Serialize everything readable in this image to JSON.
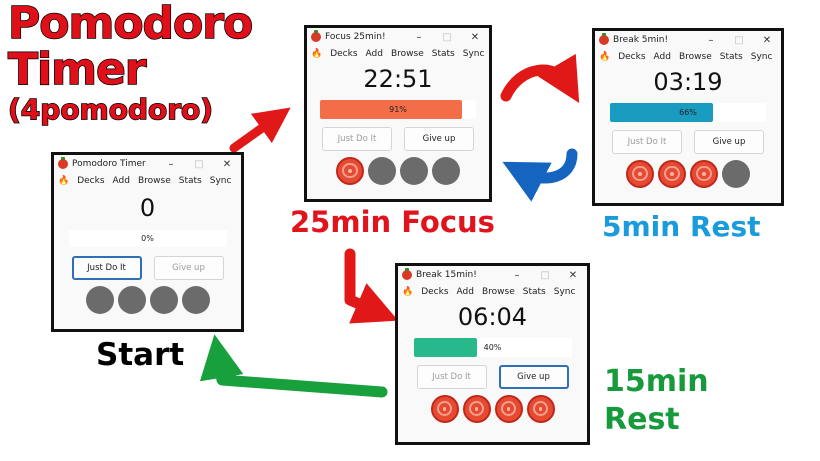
{
  "title": {
    "line1": "Pomodoro",
    "line2": "Timer",
    "line3": "(4pomodoro)",
    "color": "#e0101a"
  },
  "menu": [
    "Decks",
    "Add",
    "Browse",
    "Stats",
    "Sync"
  ],
  "windows": {
    "start": {
      "title": "Pomodoro Timer",
      "timer": "0",
      "progress_label": "0%",
      "progress": 0,
      "fill_color": "#ffffff",
      "btn_left": "Just Do It",
      "btn_right": "Give up",
      "tomatoes_done": 0,
      "tomatoes_total": 4
    },
    "focus": {
      "title": "Focus 25min!",
      "timer": "22:51",
      "progress_label": "91%",
      "progress": 0.91,
      "fill_color": "#f26d48",
      "btn_left": "Just Do It",
      "btn_right": "Give up",
      "tomatoes_done": 1,
      "tomatoes_total": 4
    },
    "break5": {
      "title": "Break 5min!",
      "timer": "03:19",
      "progress_label": "66%",
      "progress": 0.66,
      "fill_color": "#1a9bc0",
      "btn_left": "Just Do It",
      "btn_right": "Give up",
      "tomatoes_done": 3,
      "tomatoes_total": 4
    },
    "break15": {
      "title": "Break 15min!",
      "timer": "06:04",
      "progress_label": "40%",
      "progress": 0.4,
      "fill_color": "#27b98b",
      "btn_left": "Just Do It",
      "btn_right": "Give up",
      "tomatoes_done": 4,
      "tomatoes_total": 4
    }
  },
  "captions": {
    "focus": "25min Focus",
    "rest5": "5min Rest",
    "rest15_line1": "15min",
    "rest15_line2": "Rest",
    "start": "Start"
  },
  "colors": {
    "focus_caption": "#e0141c",
    "rest5_caption": "#1a9bdc",
    "rest15_caption": "#179a3c",
    "start_caption": "#000000",
    "arrow_red": "#e01818",
    "arrow_blue": "#1565c0",
    "arrow_green": "#18a03c"
  },
  "icons": {
    "window_icon": "tomato-icon",
    "menu_icon": "fire-icon"
  }
}
